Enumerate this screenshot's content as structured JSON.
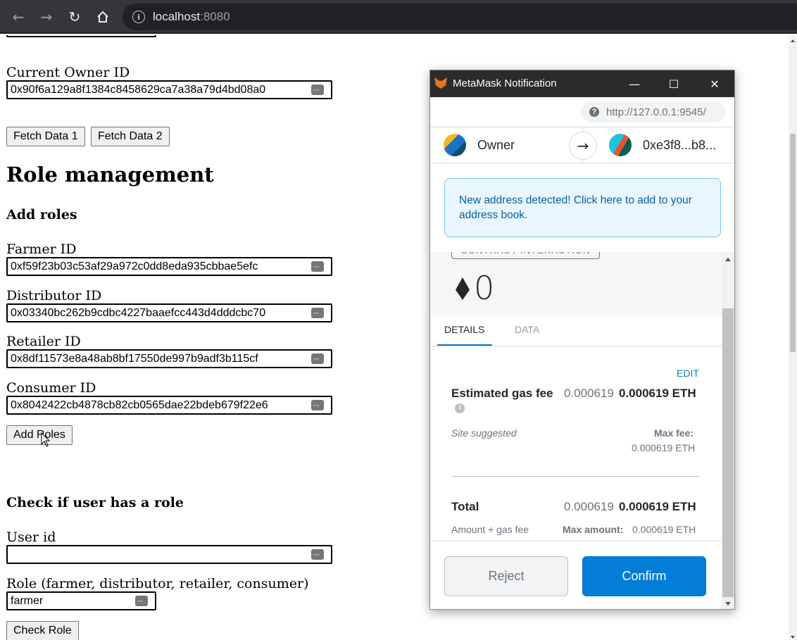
{
  "browser": {
    "url_host": "localhost",
    "url_port": ":8080"
  },
  "page": {
    "current_owner": {
      "label": "Current Owner ID",
      "value": "0x90f6a129a8f1384c8458629ca7a38a79d4bd08a0"
    },
    "fetch1_label": "Fetch Data 1",
    "fetch2_label": "Fetch Data 2",
    "role_title": "Role management",
    "add_roles_heading": "Add roles",
    "farmer": {
      "label": "Farmer ID",
      "value": "0xf59f23b03c53af29a972c0dd8eda935cbbae5efc"
    },
    "distributor": {
      "label": "Distributor ID",
      "value": "0x03340bc262b9cdbc4227baaefcc443d4dddcbc70"
    },
    "retailer": {
      "label": "Retailer ID",
      "value": "0x8df11573e8a48ab8bf17550de997b9adf3b115cf"
    },
    "consumer": {
      "label": "Consumer ID",
      "value": "0x8042422cb4878cb82cb0565dae22bdeb679f22e6"
    },
    "add_roles_button": "Add Roles",
    "check_heading": "Check if user has a role",
    "user_id": {
      "label": "User id",
      "value": ""
    },
    "role": {
      "label": "Role (farmer, distributor, retailer, consumer)",
      "value": "farmer"
    },
    "check_role_button": "Check Role"
  },
  "metamask": {
    "window_title": "MetaMask Notification",
    "origin_url": "http://127.0.0.1:9545/",
    "from_account": "Owner",
    "to_account": "0xe3f8...b8...",
    "notice": "New address detected! Click here to add to your address book.",
    "badge": "CONTRACT INTERACTION",
    "amount": "0",
    "tabs": [
      "DETAILS",
      "DATA"
    ],
    "edit_label": "EDIT",
    "gas_label": "Estimated gas fee",
    "gas_value_muted": "0.000619",
    "gas_value_eth": "0.000619 ETH",
    "site_suggested": "Site suggested",
    "max_fee_label": "Max fee:",
    "max_fee_value": "0.000619 ETH",
    "total_label": "Total",
    "total_value_muted": "0.000619",
    "total_value_eth": "0.000619 ETH",
    "amount_gas_label": "Amount + gas fee",
    "max_amount_label": "Max amount:",
    "max_amount_value": "0.000619 ETH",
    "reject_label": "Reject",
    "confirm_label": "Confirm",
    "colors": {
      "primary": "#037dd6",
      "notice_bg": "#eaf6ff",
      "notice_text": "#0360a8"
    }
  },
  "icons": [
    "back-arrow-icon",
    "forward-arrow-icon",
    "reload-icon",
    "home-icon",
    "site-info-icon",
    "keyboard-icon",
    "metamask-fox-icon",
    "minimize-icon",
    "maximize-icon",
    "close-icon",
    "question-icon",
    "arrow-right-icon",
    "ethereum-icon",
    "info-icon",
    "cursor-icon"
  ]
}
